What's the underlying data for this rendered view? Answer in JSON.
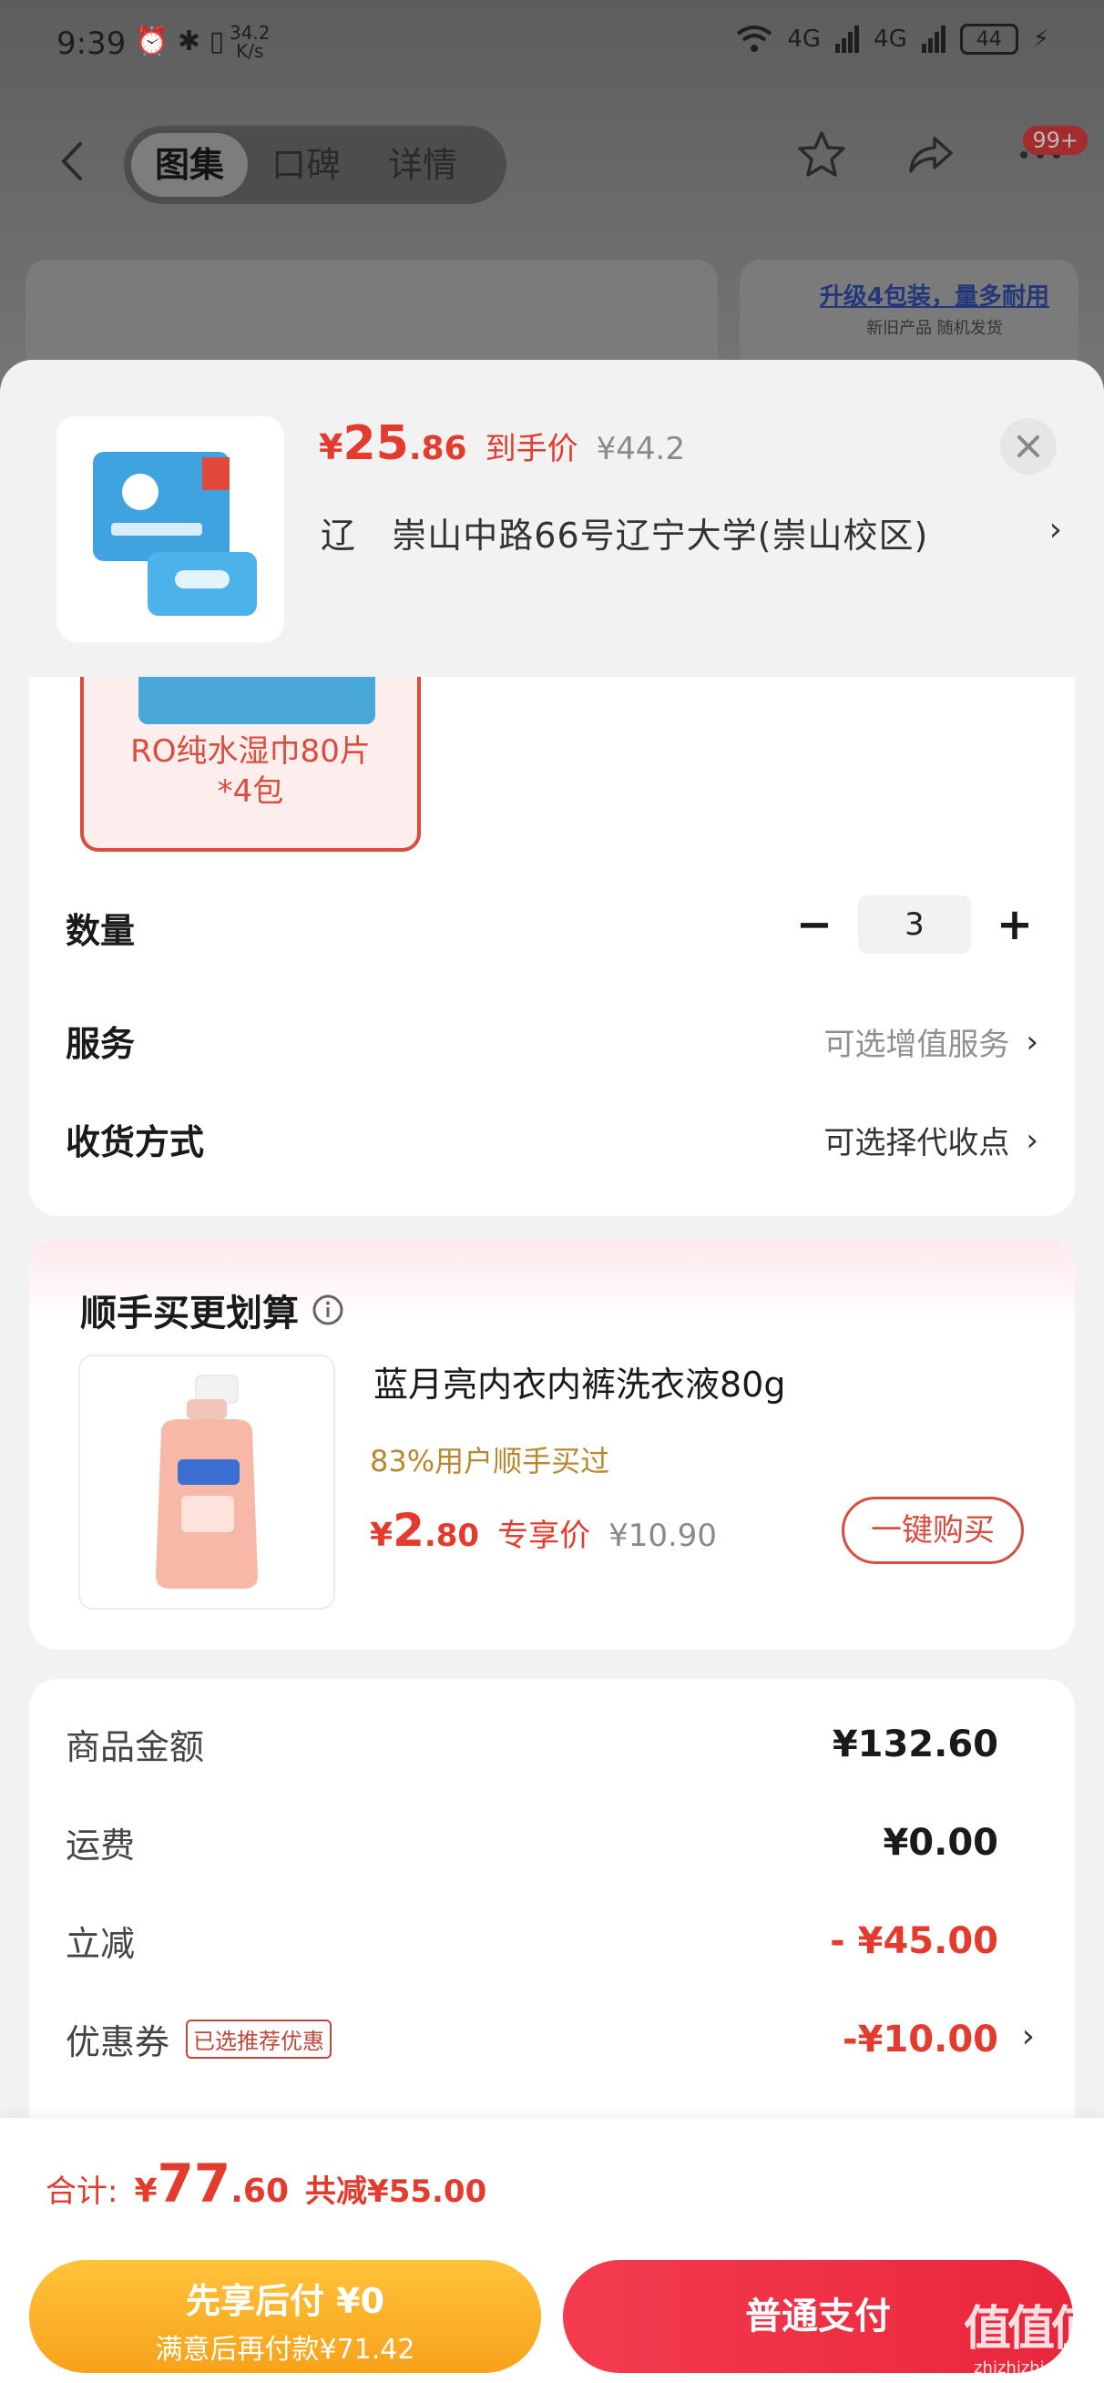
{
  "status_bar": {
    "time": "9:39",
    "left_icons": "⏰ ✱ ▯",
    "speed_value": "34.2",
    "speed_unit": "K/s",
    "net1": "4G",
    "net2": "4G",
    "battery": "44"
  },
  "nav": {
    "tabs": [
      {
        "label": "图集",
        "active": true
      },
      {
        "label": "口碑",
        "active": false
      },
      {
        "label": "详情",
        "active": false
      }
    ],
    "badge": "99+"
  },
  "background_promo": {
    "line1": "升级4包装，量多耐用",
    "line2": "新旧产品 随机发货"
  },
  "product_header": {
    "price_currency": "¥",
    "price_int": "25",
    "price_dec": ".86",
    "price_tag": "到手价",
    "original_price": "¥44.2",
    "address_prefix": "辽",
    "address": "崇山中路66号辽宁大学(崇山校区)",
    "address_arrow": "›"
  },
  "variant": {
    "label_line1": "RO纯水湿巾80片",
    "label_line2": "*4包"
  },
  "options": {
    "quantity_label": "数量",
    "quantity_value": "3",
    "minus": "−",
    "plus": "+",
    "service_label": "服务",
    "service_value": "可选增值服务",
    "delivery_label": "收货方式",
    "delivery_value": "可选择代收点",
    "arrow": "›"
  },
  "addon": {
    "title": "顺手买更划算",
    "product_name": "蓝月亮内衣内裤洗衣液80g",
    "social_proof": "83%用户顺手买过",
    "price_currency": "¥",
    "price_int": "2",
    "price_dec": ".80",
    "price_tag": "专享价",
    "original_price": "¥10.90",
    "buy_button": "一键购买"
  },
  "summary": {
    "rows": [
      {
        "label": "商品金额",
        "value": "¥132.60"
      },
      {
        "label": "运费",
        "value": "¥0.00"
      },
      {
        "label": "立减",
        "value": "- ¥45.00"
      },
      {
        "label": "优惠券",
        "tag": "已选推荐优惠",
        "value": "-¥10.00"
      }
    ]
  },
  "bottom": {
    "total_label": "合计:",
    "total_currency": "¥",
    "total_int": "77",
    "total_dec": ".60",
    "total_saved": "共减¥55.00",
    "paylater_main": "先享后付 ¥0",
    "paylater_sub": "满意后再付款¥71.42",
    "pay_button": "普通支付"
  },
  "watermark": {
    "main": "值值值",
    "sub": "zhizhizhi.com"
  },
  "colors": {
    "accent_red": "#e33c2e",
    "pay_red": "#f43c4f",
    "paylater_orange": "#f7a21b",
    "social_gold": "#b8882e"
  }
}
